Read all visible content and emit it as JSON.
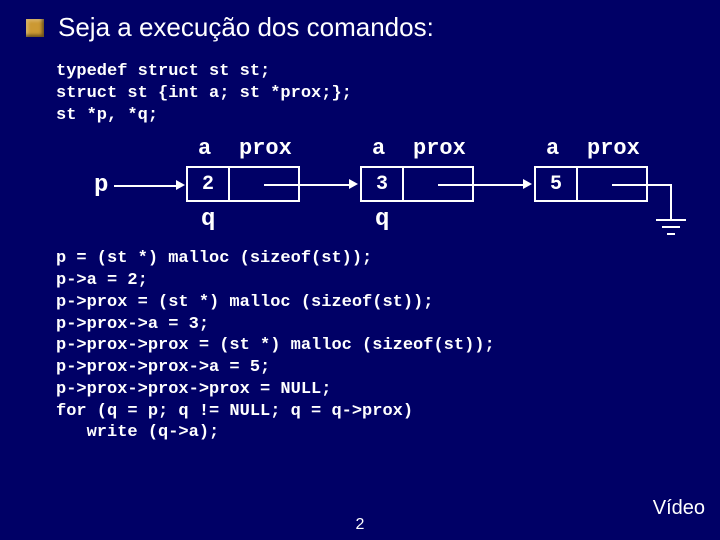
{
  "title": "Seja a execução dos comandos:",
  "code1": {
    "l1": "typedef struct st st;",
    "l2": "struct st {int a; st *prox;};",
    "l3": "st *p, *q;"
  },
  "diagram": {
    "p": "p",
    "a": "a",
    "prox": "prox",
    "v1": "2",
    "v2": "3",
    "v3": "5",
    "q": "q"
  },
  "code2": {
    "l1": "p = (st *) malloc (sizeof(st));",
    "l2": "p->a = 2;",
    "l3": "p->prox = (st *) malloc (sizeof(st));",
    "l4": "p->prox->a = 3;",
    "l5": "p->prox->prox = (st *) malloc (sizeof(st));",
    "l6": "p->prox->prox->a = 5;",
    "l7": "p->prox->prox->prox = NULL;",
    "l8": "for (q = p; q != NULL; q = q->prox)",
    "l9": "   write (q->a);"
  },
  "video": "Vídeo",
  "page": "2"
}
